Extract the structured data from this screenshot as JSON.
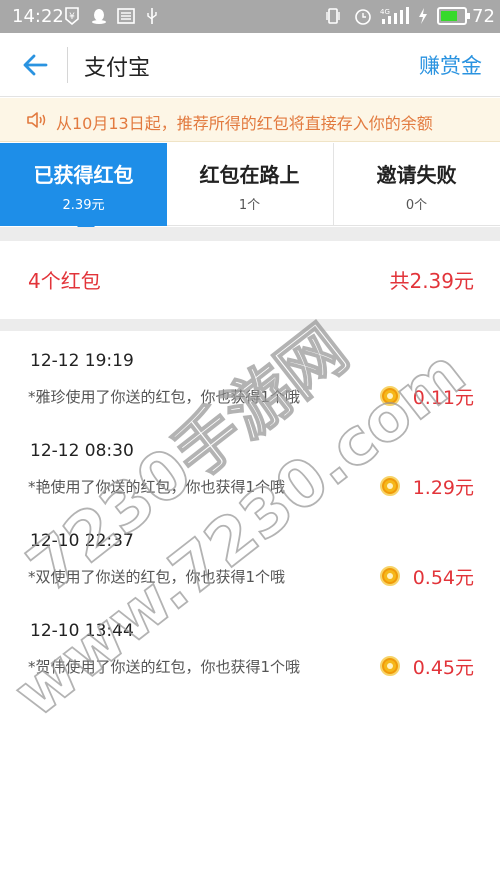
{
  "status_bar": {
    "time": "14:22",
    "battery_level": "72",
    "network_label": "4G",
    "icons": [
      "yuan-icon",
      "qq-icon",
      "news-icon",
      "usb-icon",
      "vibrate-icon",
      "alarm-icon",
      "signal-icon",
      "charging-icon",
      "battery-icon"
    ]
  },
  "header": {
    "title": "支付宝",
    "reward_link": "赚赏金",
    "back_icon": "back-arrow-icon"
  },
  "notice": {
    "text": "从10月13日起，推荐所得的红包将直接存入你的余额",
    "icon": "speaker-icon"
  },
  "tabs": [
    {
      "label": "已获得红包",
      "sub": "2.39元",
      "active": true
    },
    {
      "label": "红包在路上",
      "sub": "1个",
      "active": false
    },
    {
      "label": "邀请失败",
      "sub": "0个",
      "active": false
    }
  ],
  "summary": {
    "count": "4个红包",
    "total": "共2.39元"
  },
  "items": [
    {
      "date": "12-12  19:19",
      "desc": "*雅珍使用了你送的红包，你也获得1个哦",
      "amount": "0.11元"
    },
    {
      "date": "12-12  08:30",
      "desc": "*艳使用了你送的红包，你也获得1个哦",
      "amount": "1.29元"
    },
    {
      "date": "12-10  22:37",
      "desc": "*双使用了你送的红包，你也获得1个哦",
      "amount": "0.54元"
    },
    {
      "date": "12-10  13:44",
      "desc": "*贺伟使用了你送的红包，你也获得1个哦",
      "amount": "0.45元"
    }
  ],
  "watermark": {
    "line1": "7230手游网",
    "line2": "www.7230.com"
  },
  "colors": {
    "accent": "#1e8ee8",
    "link": "#2a93e0",
    "amount": "#e2343a",
    "notice_text": "#e27a3f",
    "notice_bg": "#fdf6e6"
  }
}
